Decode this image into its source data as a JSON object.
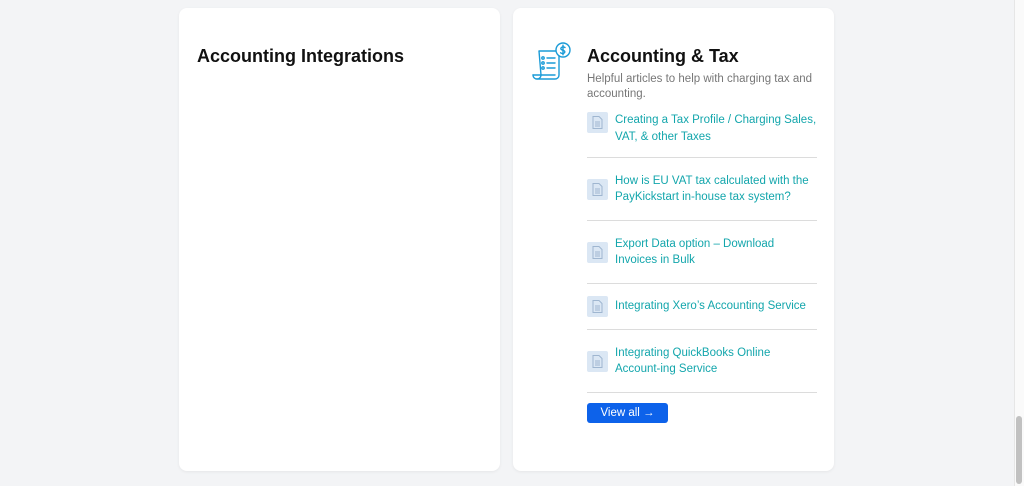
{
  "cards": [
    {
      "title": "Accounting Integrations"
    },
    {
      "title": "Accounting & Tax",
      "icon": "invoice-dollar-icon",
      "subtitle": "Helpful articles to help with charging tax and accounting.",
      "articles": [
        {
          "label": "Creating a Tax Profile / Charging Sales, VAT, & other Taxes"
        },
        {
          "label": "How is EU VAT tax calculated with the PayKickstart in-house tax system?"
        },
        {
          "label": "Export Data option – Download Invoices in Bulk"
        },
        {
          "label": "Integrating Xero’s Accounting Service"
        },
        {
          "label": "Integrating QuickBooks Online Account-ing Service"
        }
      ],
      "view_all_label": "View all →"
    }
  ],
  "colors": {
    "accent": "#0d62ea",
    "link": "#13a6ac",
    "icon_bg": "#dbe7f4",
    "icon_stroke": "#1a9bd7"
  }
}
